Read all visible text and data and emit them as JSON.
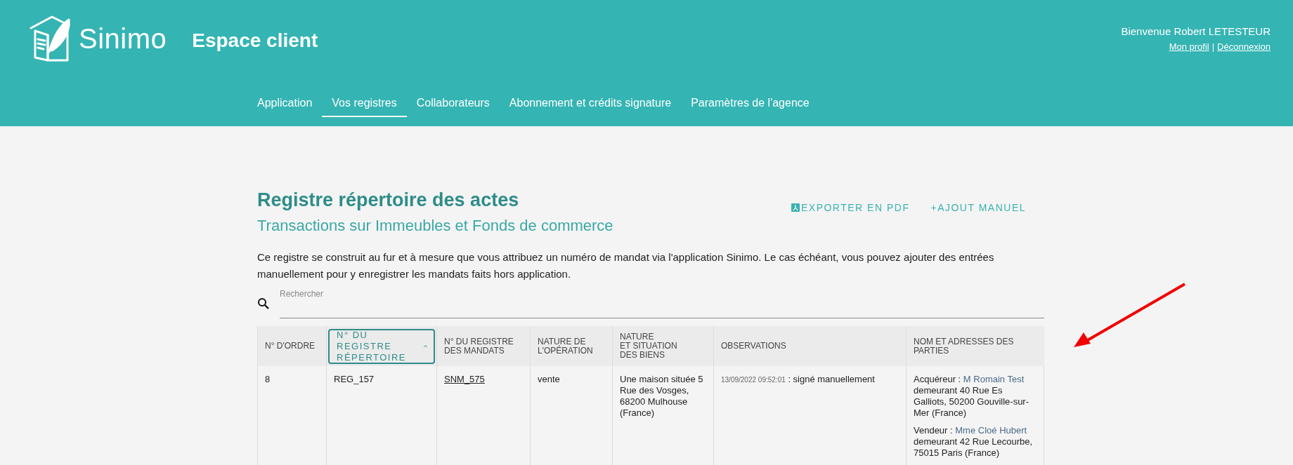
{
  "header": {
    "brand": "Sinimo",
    "title": "Espace client",
    "welcome": "Bienvenue Robert LETESTEUR",
    "links": [
      {
        "label": "Mon profil"
      },
      {
        "label": "Déconnexion"
      }
    ],
    "separator": "|"
  },
  "nav": [
    {
      "label": "Application",
      "selected": false
    },
    {
      "label": "Vos registres",
      "selected": true
    },
    {
      "label": "Collaborateurs",
      "selected": false
    },
    {
      "label": "Abonnement et crédits signature",
      "selected": false
    },
    {
      "label": "Paramètres de l'agence",
      "selected": false
    }
  ],
  "page": {
    "title": "Registre répertoire des actes",
    "subtitle": "Transactions sur Immeubles et Fonds de commerce",
    "actions": [
      {
        "kind": "pdf",
        "label": "EXPORTER EN PDF"
      },
      {
        "kind": "plain",
        "label": "+AJOUT MANUEL"
      }
    ],
    "intro": "Ce registre se construit au fur et à mesure que vous attribuez un numéro de mandat via l'application Sinimo. Le cas échéant, vous pouvez ajouter des entrées manuellement pour y enregistrer les mandats faits hors application."
  },
  "search": {
    "placeholder": "Rechercher"
  },
  "table": {
    "columns": [
      {
        "label": "N° D'ORDRE",
        "sorted": false
      },
      {
        "label": "N° DU REGISTRE RÉPERTOIRE",
        "sorted": true
      },
      {
        "label": "N° DU REGISTRE DES MANDATS",
        "sorted": false
      },
      {
        "label": "NATURE DE L'OPÉRATION",
        "sorted": false
      },
      {
        "label": "NATURE\nET SITUATION\nDES BIENS",
        "sorted": false
      },
      {
        "label": "OBSERVATIONS",
        "sorted": false
      },
      {
        "label": "NOM ET ADRESSES DES PARTIES",
        "sorted": false
      }
    ],
    "rows": [
      {
        "order": "8",
        "register": "REG_157",
        "mandate": "SNM_575",
        "operation": "vente",
        "property": "Une maison située 5 Rue des Vosges, 68200 Mulhouse (France)",
        "observation": {
          "timestamp": "13/09/2022 09:52:01",
          "text": ": signé manuellement"
        },
        "parties": [
          {
            "role": "Acquéreur :",
            "name": "M Romain Test",
            "address": "demeurant 40 Rue Es Galliots, 50200 Gouville-sur-Mer (France)"
          },
          {
            "role": "Vendeur :",
            "name": "Mme Cloé Hubert",
            "address": "demeurant 42 Rue Lecourbe, 75015 Paris (France)"
          }
        ]
      }
    ]
  },
  "annotation": {
    "kind": "arrow"
  }
}
